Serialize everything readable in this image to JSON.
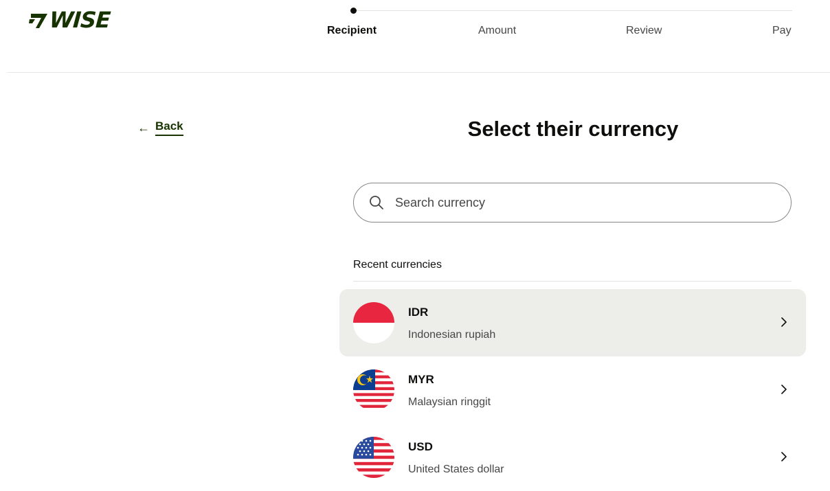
{
  "logo": {
    "text": "WISE"
  },
  "stepper": {
    "steps": [
      "Recipient",
      "Amount",
      "Review",
      "Pay"
    ],
    "active_index": 0
  },
  "nav": {
    "back_label": "Back"
  },
  "page": {
    "title": "Select their currency"
  },
  "search": {
    "placeholder": "Search currency",
    "value": ""
  },
  "recent": {
    "label": "Recent currencies",
    "currencies": [
      {
        "code": "IDR",
        "name": "Indonesian rupiah",
        "flag": "indonesia-flag-icon"
      },
      {
        "code": "MYR",
        "name": "Malaysian ringgit",
        "flag": "malaysia-flag-icon"
      },
      {
        "code": "USD",
        "name": "United States dollar",
        "flag": "usa-flag-icon"
      }
    ]
  },
  "colors": {
    "brand": "#163300",
    "text": "#0e0f0c",
    "secondary_text": "#454745",
    "row_highlight": "#edeeea",
    "indonesia_red": "#e8263f",
    "malaysia_blue": "#0b3d91",
    "malaysia_yellow": "#f5c518",
    "usa_blue": "#2a4a9e",
    "usa_red": "#e1253b"
  }
}
